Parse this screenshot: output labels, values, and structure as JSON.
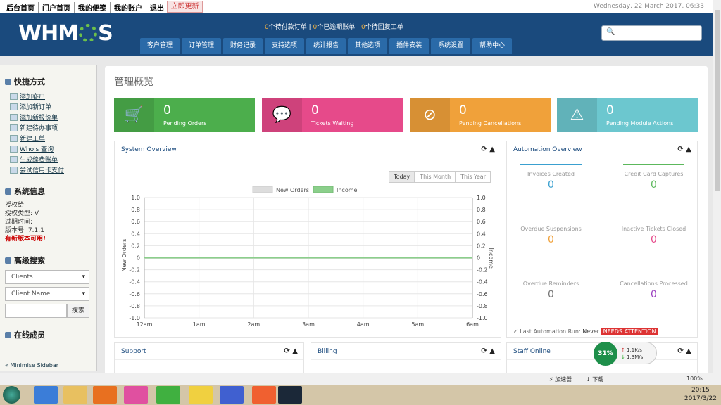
{
  "topbar": {
    "links": [
      "后台首页",
      "门户首页",
      "我的便笺",
      "我的账户",
      "退出"
    ],
    "update": "立即更新",
    "date": "Wednesday, 22 March 2017, 06:33"
  },
  "header": {
    "logo": "WHMCS",
    "alerts": [
      {
        "n": "0",
        "t": "个待付款订单"
      },
      {
        "n": "0",
        "t": "个已逾期账单"
      },
      {
        "n": "0",
        "t": "个待回复工单"
      }
    ]
  },
  "nav": [
    "客户管理",
    "订单管理",
    "财务记录",
    "支持选项",
    "统计报告",
    "其他选项",
    "插件安装",
    "系统设置",
    "帮助中心"
  ],
  "sidebar": {
    "shortcuts_title": "快捷方式",
    "shortcuts": [
      "添加客户",
      "添加新订单",
      "添加新报价单",
      "新建待办事项",
      "新建工单",
      "Whois 查询",
      "生成续费账单",
      "尝试信用卡支付"
    ],
    "sysinfo_title": "系统信息",
    "sysinfo": [
      "授权给:",
      "授权类型: V",
      "过期时间:",
      "版本号: 7.1.1"
    ],
    "newver": "有新版本可用!",
    "adv_title": "高级搜索",
    "select1": "Clients",
    "select2": "Client Name",
    "search_btn": "搜索",
    "online_title": "在线成员",
    "minimise": "« Minimise Sidebar"
  },
  "main": {
    "title": "管理概览",
    "stats": [
      {
        "value": "0",
        "label": "Pending Orders",
        "icon": "cart-icon",
        "color": "#4cae4c"
      },
      {
        "value": "0",
        "label": "Tickets Waiting",
        "icon": "comment-icon",
        "color": "#e64a8a"
      },
      {
        "value": "0",
        "label": "Pending Cancellations",
        "icon": "ban-icon",
        "color": "#f0a13a"
      },
      {
        "value": "0",
        "label": "Pending Module Actions",
        "icon": "warning-icon",
        "color": "#6cc7cf"
      }
    ]
  },
  "panels": {
    "system": "System Overview",
    "automation": "Automation Overview",
    "support": "Support",
    "billing": "Billing",
    "staff": "Staff Online"
  },
  "chart_tabs": [
    "Today",
    "This Month",
    "This Year"
  ],
  "automation": [
    {
      "t": "Invoices Created",
      "v": "0",
      "c": "#3aa0d0"
    },
    {
      "t": "Credit Card Captures",
      "v": "0",
      "c": "#5cb85c"
    },
    {
      "t": "Overdue Suspensions",
      "v": "0",
      "c": "#f0a13a"
    },
    {
      "t": "Inactive Tickets Closed",
      "v": "0",
      "c": "#e64a8a"
    },
    {
      "t": "Overdue Reminders",
      "v": "0",
      "c": "#777"
    },
    {
      "t": "Cancellations Processed",
      "v": "0",
      "c": "#9b3fc0"
    }
  ],
  "lastrun": {
    "label": "Last Automation Run:",
    "value": "Never",
    "need": "NEEDS ATTENTION"
  },
  "chart_data": {
    "type": "line",
    "x": [
      "12am",
      "1am",
      "2am",
      "3am",
      "4am",
      "5am",
      "6am"
    ],
    "series": [
      {
        "name": "New Orders",
        "values": [
          0,
          0,
          0,
          0,
          0,
          0,
          0
        ],
        "color": "#dddddd"
      },
      {
        "name": "Income",
        "values": [
          0,
          0,
          0,
          0,
          0,
          0,
          0
        ],
        "color": "#8bcf8b"
      }
    ],
    "ylabel": "New Orders",
    "ylabel_right": "Income",
    "ylim": [
      -1,
      1
    ],
    "yticks": [
      "1.0",
      "0.8",
      "0.6",
      "0.4",
      "0.2",
      "0",
      "-0.2",
      "-0.4",
      "-0.6",
      "-0.8",
      "-1.0"
    ],
    "legend": "top-center",
    "grid": true
  },
  "status": {
    "accel": "加速器",
    "download": "下载",
    "zoom": "100%",
    "net_pct": "31%",
    "up": "1.1K/s",
    "down": "1.3M/s"
  },
  "clock": {
    "time": "20:15",
    "date": "2017/3/22"
  }
}
